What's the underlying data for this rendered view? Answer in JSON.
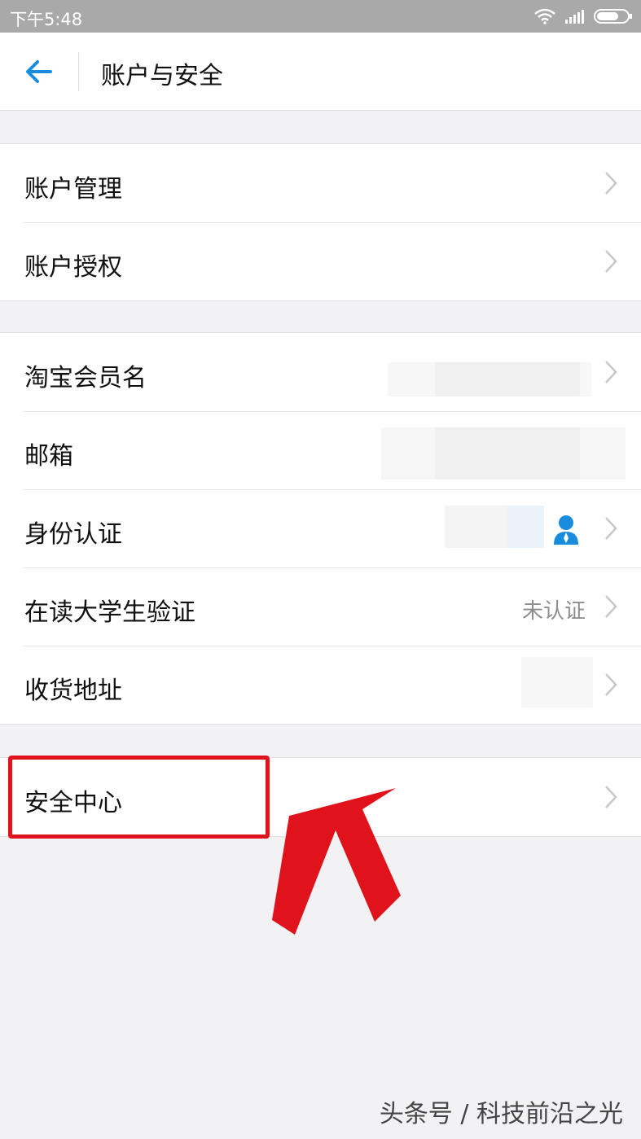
{
  "status_bar": {
    "time": "下午5:48"
  },
  "header": {
    "title": "账户与安全"
  },
  "groups": [
    {
      "items": [
        {
          "label": "账户管理"
        },
        {
          "label": "账户授权"
        }
      ]
    },
    {
      "items": [
        {
          "label": "淘宝会员名"
        },
        {
          "label": "邮箱"
        },
        {
          "label": "身份认证"
        },
        {
          "label": "在读大学生验证",
          "value": "未认证"
        },
        {
          "label": "收货地址"
        }
      ]
    },
    {
      "items": [
        {
          "label": "安全中心"
        }
      ]
    }
  ],
  "watermark": "头条号 / 科技前沿之光",
  "colors": {
    "accent": "#1a8cde",
    "highlight": "#e0121b",
    "background": "#f2f2f5"
  }
}
